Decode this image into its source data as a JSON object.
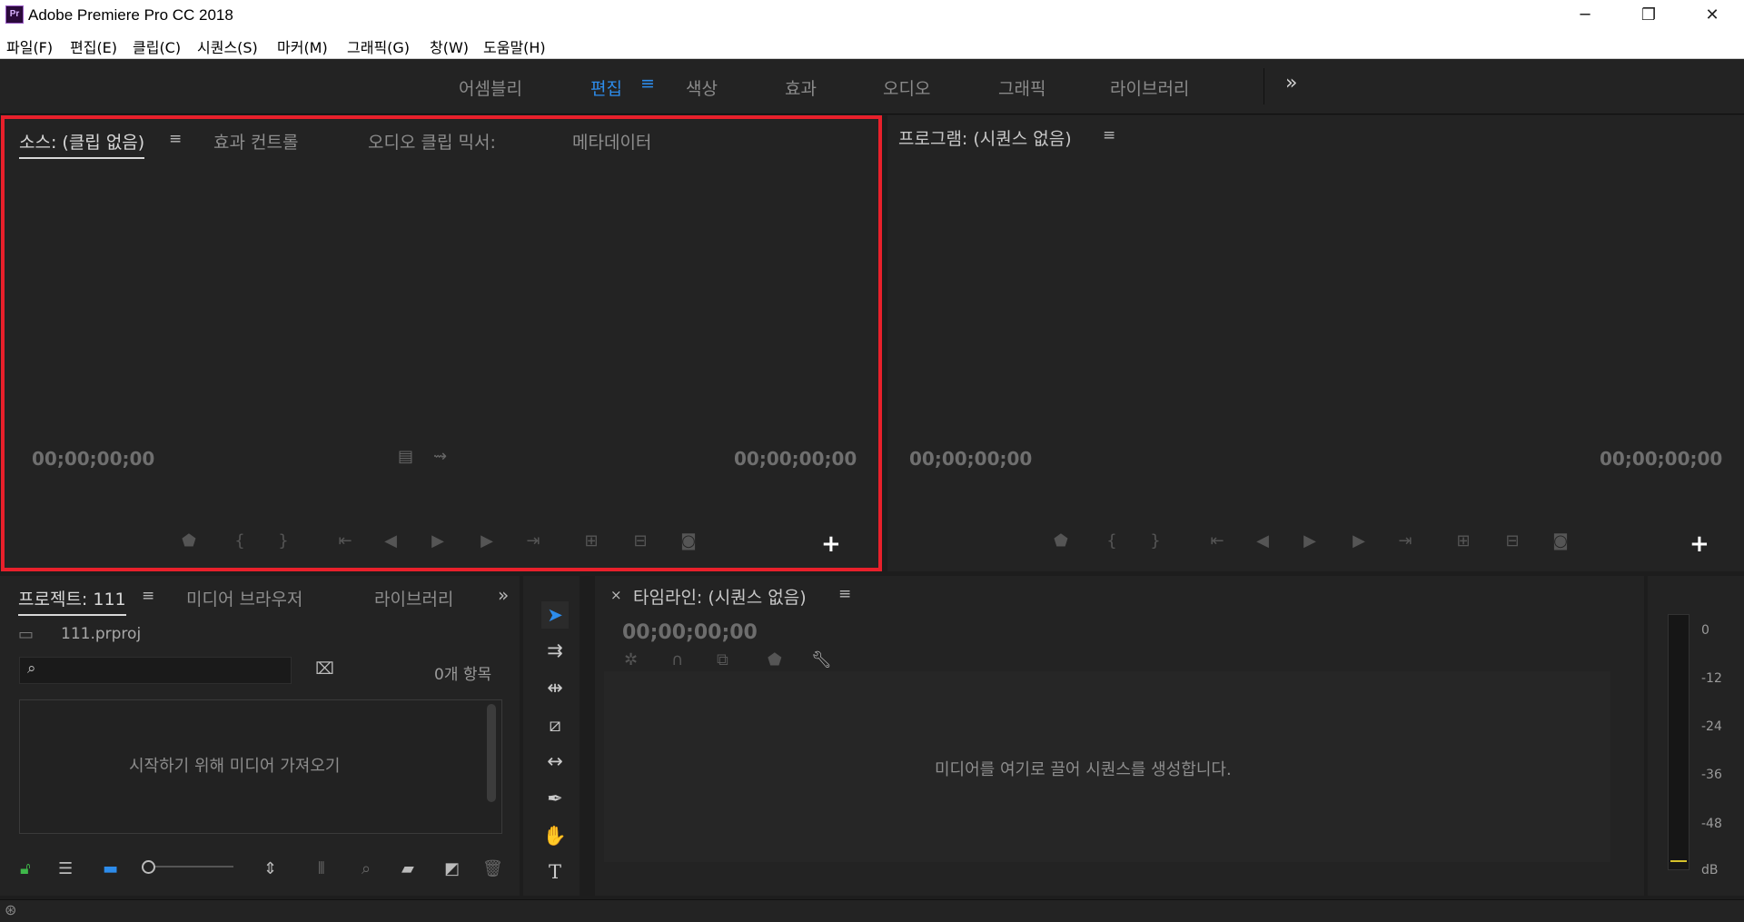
{
  "window": {
    "title": "Adobe Premiere Pro CC 2018",
    "app_icon_text": "Pr",
    "minimize": "─",
    "restore": "❐",
    "close": "✕"
  },
  "menu": [
    "파일(F)",
    "편집(E)",
    "클립(C)",
    "시퀀스(S)",
    "마커(M)",
    "그래픽(G)",
    "창(W)",
    "도움말(H)"
  ],
  "workspaces": {
    "tabs": [
      "어셈블리",
      "편집",
      "색상",
      "효과",
      "오디오",
      "그래픽",
      "라이브러리"
    ],
    "active": "편집",
    "menu_icon": "≡",
    "overflow_icon": "»",
    "active_color": "#2d8ceb"
  },
  "source_panel": {
    "tabs": [
      "소스: (클립 없음)",
      "효과 컨트롤",
      "오디오 클립 믹서:",
      "메타데이터"
    ],
    "menu_icon": "≡",
    "timecode_left": "00;00;00;00",
    "timecode_right": "00;00;00;00",
    "highlight_color": "#e8202b"
  },
  "program_panel": {
    "tab": "프로그램: (시퀀스 없음)",
    "menu_icon": "≡",
    "timecode_left": "00;00;00;00",
    "timecode_right": "00;00;00;00"
  },
  "transport_icons": [
    "marker-icon",
    "mark-in-icon",
    "mark-out-icon",
    "go-to-in-icon",
    "step-back-icon",
    "play-icon",
    "step-forward-icon",
    "go-to-out-icon",
    "insert-icon",
    "overwrite-icon",
    "export-frame-icon"
  ],
  "project_panel": {
    "tabs": [
      "프로젝트: 111",
      "미디어 브라우저",
      "라이브러리"
    ],
    "menu_icon": "≡",
    "overflow_icon": "»",
    "project_file": "111.prproj",
    "item_count": "0개 항목",
    "search_placeholder": "",
    "empty_message": "시작하기 위해 미디어 가져오기"
  },
  "tools": [
    "selection-tool",
    "track-select-tool",
    "ripple-edit-tool",
    "razor-tool",
    "slip-tool",
    "pen-tool",
    "hand-tool",
    "type-tool"
  ],
  "timeline_panel": {
    "close_icon": "×",
    "tab": "타임라인: (시퀀스 없음)",
    "menu_icon": "≡",
    "timecode": "00;00;00;00",
    "empty_message": "미디어를 여기로 끌어 시퀀스를 생성합니다."
  },
  "audio_meter": {
    "labels": [
      "0",
      "-12",
      "-24",
      "-36",
      "-48",
      "dB"
    ]
  }
}
